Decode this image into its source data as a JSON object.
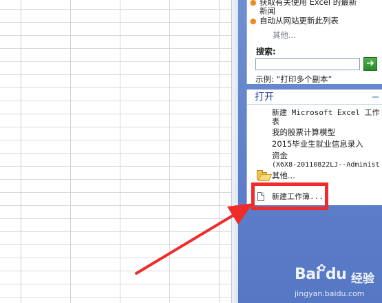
{
  "help_panel": {
    "items": [
      {
        "label_line1": "获取有关使用 Excel 的最新",
        "label_line2": "新闻"
      },
      {
        "label_line1": "自动从网站更新此列表"
      }
    ],
    "more_label": "其他...",
    "search_label": "搜索:",
    "search_value": "",
    "search_go_glyph": "➔",
    "example_text": "示例: “打印多个副本”"
  },
  "open_panel": {
    "title": "打开",
    "files": [
      {
        "line1": "新建 Microsoft Excel 工作",
        "line2": "表"
      },
      {
        "line1": "我的股票计算模型"
      },
      {
        "line1": "2015毕业生就业信息录入"
      },
      {
        "line1": "资金",
        "line2": "(X6X8-20110822LJ--Administ"
      }
    ],
    "more_label": "其他...",
    "new_workbook_label": "新建工作簿..."
  },
  "annotation": {
    "color": "#ef2b2b"
  },
  "watermark": {
    "logo": "Bai du",
    "jingyan": "经验",
    "url": "jingyan.baidu.com"
  }
}
